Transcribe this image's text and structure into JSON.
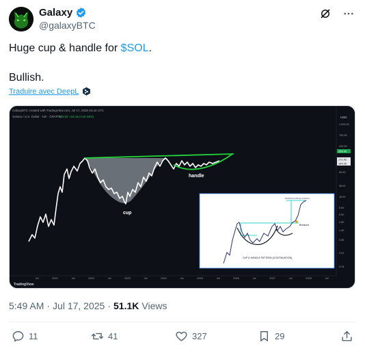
{
  "author": {
    "display_name": "Galaxy",
    "handle": "@galaxyBTC"
  },
  "tweet": {
    "text_before": "Huge cup & handle for ",
    "cashtag": "$SOL",
    "text_after": ".",
    "line2": "Bullish.",
    "translate_label": "Traduire avec DeepL"
  },
  "chart_image": {
    "header_text": "GalaxyBTC created with TradingView.com, Jul 17, 2025 04:42 UTC",
    "symbol_text": "Solana / U.S. Dollar · 1W · CRYPTO",
    "ohlc_text": "171.02 +16.16 (+10.44%)",
    "currency": "USD",
    "price_ticks": [
      "1,200.00",
      "700.00",
      "420.00",
      "171.02",
      "80.00",
      "38.00",
      "16.00",
      "9.00",
      "5.90",
      "2.80",
      "1.40",
      "0.65",
      "0.31",
      "0.15"
    ],
    "price_badges": [
      "269.00",
      "171.02",
      "164.20"
    ],
    "time_ticks": [
      "Jul",
      "2021",
      "Jul",
      "2022",
      "Jul",
      "2023",
      "Jul",
      "2024",
      "Jul",
      "2025",
      "Jul",
      "2026",
      "Jul",
      "2027",
      "Jul",
      "2028",
      "Jul"
    ],
    "cup_label": "cup",
    "handle_label": "handle",
    "inset_title": "CUP & HANDLE PATTERN (CONTINUATION)",
    "inset_breakout": "Breakout",
    "inset_target": "MINIMUM PRICE TARGET",
    "watermark": "TradingView",
    "colors": {
      "resistance": "#22d63a",
      "handle": "#22d63a",
      "price_line": "#ffffff",
      "cup_fill": "#8a9099",
      "inset_line": "#2a2f6e",
      "inset_accent": "#2dd4bf"
    }
  },
  "meta": {
    "time": "5:49 AM",
    "date": "Jul 17, 2025",
    "views_count": "51.1K",
    "views_label": "Views"
  },
  "actions": {
    "replies": "11",
    "reposts": "41",
    "likes": "327",
    "bookmarks": "29"
  },
  "icons": [
    "verified-badge-icon",
    "grok-icon",
    "more-icon",
    "deepl-icon",
    "reply-icon",
    "repost-icon",
    "like-icon",
    "bookmark-icon",
    "share-icon"
  ]
}
